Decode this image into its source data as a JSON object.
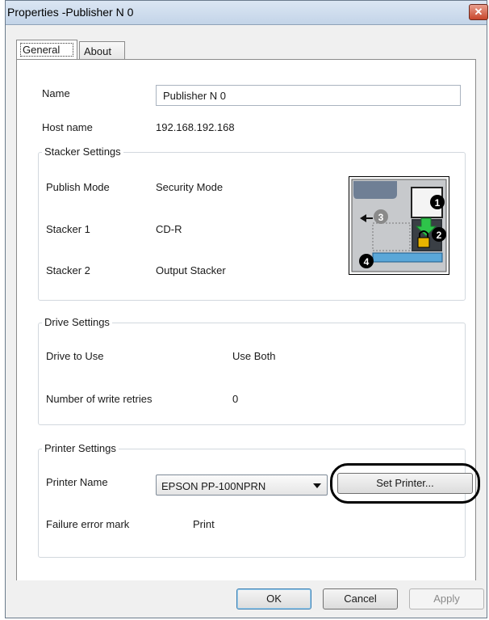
{
  "window": {
    "title": "Properties -Publisher N 0",
    "close_glyph": "✕"
  },
  "tabs": [
    {
      "label": "General"
    },
    {
      "label": "About"
    }
  ],
  "general": {
    "name_label": "Name",
    "name_value": "Publisher N 0",
    "host_label": "Host name",
    "host_value": "192.168.192.168"
  },
  "stacker": {
    "title": "Stacker Settings",
    "publish_mode_label": "Publish Mode",
    "publish_mode_value": "Security Mode",
    "stacker1_label": "Stacker 1",
    "stacker1_value": "CD-R",
    "stacker2_label": "Stacker 2",
    "stacker2_value": "Output Stacker",
    "diagram_numbers": [
      "1",
      "2",
      "3",
      "4"
    ]
  },
  "drive": {
    "title": "Drive Settings",
    "drive_label": "Drive to Use",
    "drive_value": "Use Both",
    "retries_label": "Number of write retries",
    "retries_value": "0"
  },
  "printer": {
    "title": "Printer Settings",
    "name_label": "Printer Name",
    "name_value": "EPSON PP-100NPRN",
    "set_button": "Set Printer...",
    "failure_label": "Failure error mark",
    "failure_value": "Print"
  },
  "footer": {
    "ok": "OK",
    "cancel": "Cancel",
    "apply": "Apply"
  },
  "colors": {
    "highlight": "#000000",
    "lock": "#e8b400",
    "arrow": "#2ec44a",
    "stacker_blue": "#5aa7d8"
  }
}
